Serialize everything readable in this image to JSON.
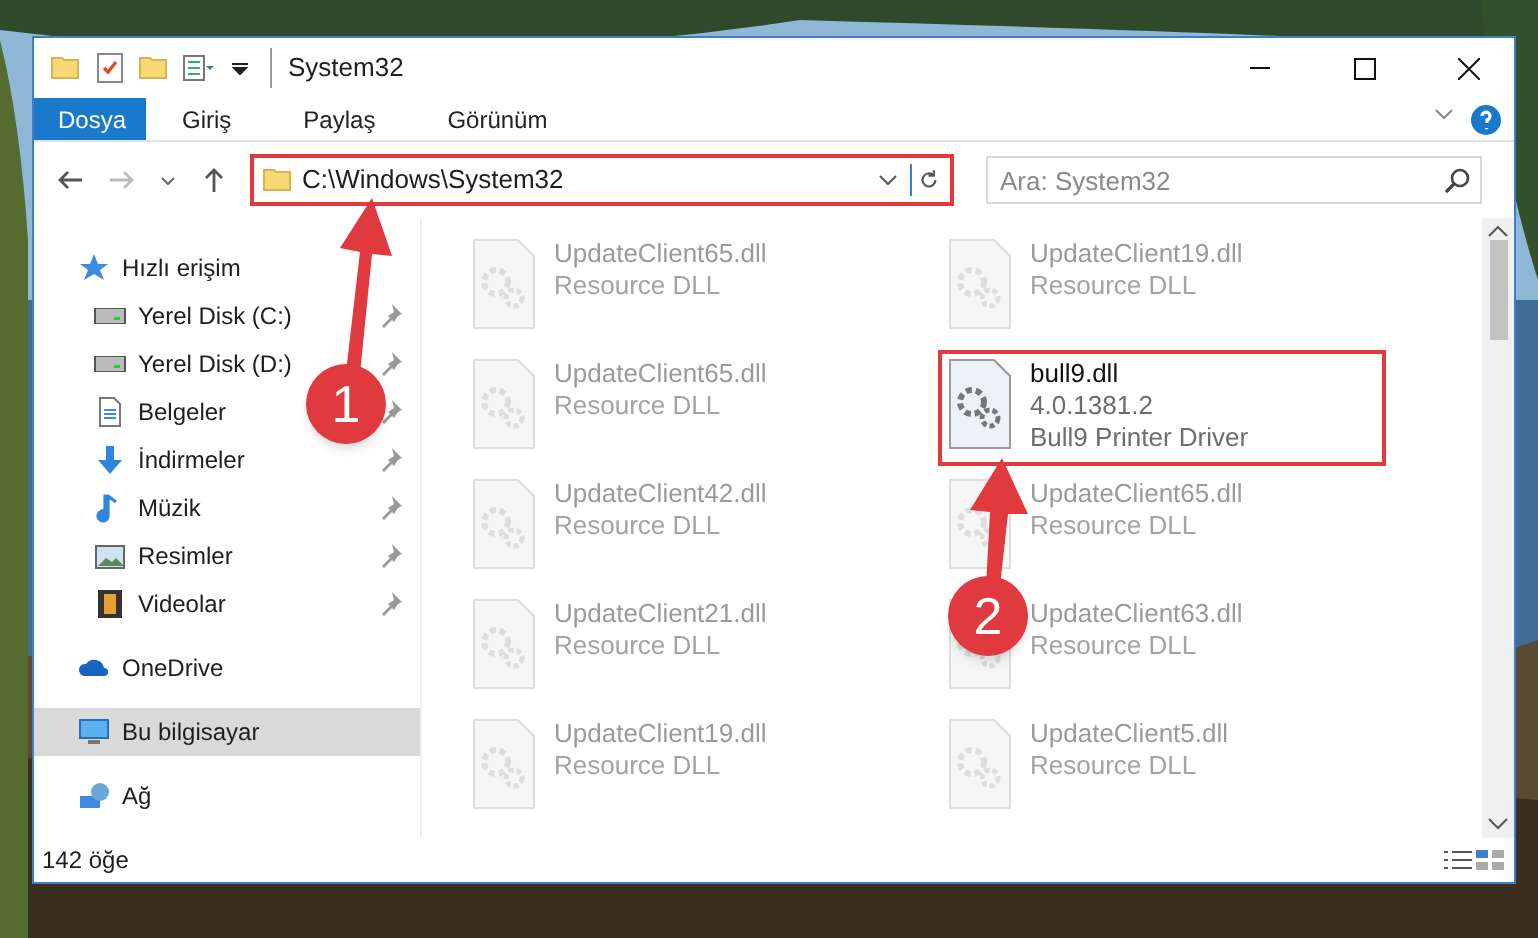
{
  "window": {
    "title": "System32"
  },
  "ribbon": {
    "tabs": [
      {
        "label": "Dosya",
        "selected": true
      },
      {
        "label": "Giriş",
        "selected": false
      },
      {
        "label": "Paylaş",
        "selected": false
      },
      {
        "label": "Görünüm",
        "selected": false
      }
    ]
  },
  "address_bar": {
    "path": "C:\\Windows\\System32",
    "highlighted": true
  },
  "search": {
    "placeholder": "Ara: System32"
  },
  "sidebar": {
    "items": [
      {
        "label": "Hızlı erişim",
        "kind": "star",
        "selected": false,
        "children": [
          {
            "label": "Yerel Disk (C:)",
            "kind": "drive",
            "pinned": true,
            "selected": false
          },
          {
            "label": "Yerel Disk (D:)",
            "kind": "drive",
            "pinned": true,
            "selected": false
          },
          {
            "label": "Belgeler",
            "kind": "document",
            "pinned": true,
            "selected": false
          },
          {
            "label": "İndirmeler",
            "kind": "download",
            "pinned": true,
            "selected": false
          },
          {
            "label": "Müzik",
            "kind": "music",
            "pinned": true,
            "selected": false
          },
          {
            "label": "Resimler",
            "kind": "pictures",
            "pinned": true,
            "selected": false
          },
          {
            "label": "Videolar",
            "kind": "video",
            "pinned": true,
            "selected": false
          }
        ]
      },
      {
        "label": "OneDrive",
        "kind": "cloud",
        "selected": false
      },
      {
        "label": "Bu bilgisayar",
        "kind": "computer",
        "selected": true
      },
      {
        "label": "Ağ",
        "kind": "network",
        "selected": false
      }
    ]
  },
  "files": [
    {
      "name": "UpdateClient65.dll",
      "lines": [
        "Resource DLL"
      ],
      "kind": "blurred",
      "highlighted": false
    },
    {
      "name": "UpdateClient19.dll",
      "lines": [
        "Resource DLL"
      ],
      "kind": "blurred",
      "highlighted": false
    },
    {
      "name": "UpdateClient65.dll",
      "lines": [
        "Resource DLL"
      ],
      "kind": "blurred",
      "highlighted": false
    },
    {
      "name": "bull9.dll",
      "lines": [
        "4.0.1381.2",
        "Bull9 Printer Driver"
      ],
      "kind": "focus",
      "highlighted": true
    },
    {
      "name": "UpdateClient42.dll",
      "lines": [
        "Resource DLL"
      ],
      "kind": "blurred",
      "highlighted": false
    },
    {
      "name": "UpdateClient65.dll",
      "lines": [
        "Resource DLL"
      ],
      "kind": "blurred",
      "highlighted": false
    },
    {
      "name": "UpdateClient21.dll",
      "lines": [
        "Resource DLL"
      ],
      "kind": "blurred",
      "highlighted": false
    },
    {
      "name": "UpdateClient63.dll",
      "lines": [
        "Resource DLL"
      ],
      "kind": "blurred",
      "highlighted": false
    },
    {
      "name": "UpdateClient19.dll",
      "lines": [
        "Resource DLL"
      ],
      "kind": "blurred",
      "highlighted": false
    },
    {
      "name": "UpdateClient5.dll",
      "lines": [
        "Resource DLL"
      ],
      "kind": "blurred",
      "highlighted": false
    }
  ],
  "status_bar": {
    "count": "142 öğe"
  },
  "annotations": [
    {
      "label": "1"
    },
    {
      "label": "2"
    }
  ]
}
